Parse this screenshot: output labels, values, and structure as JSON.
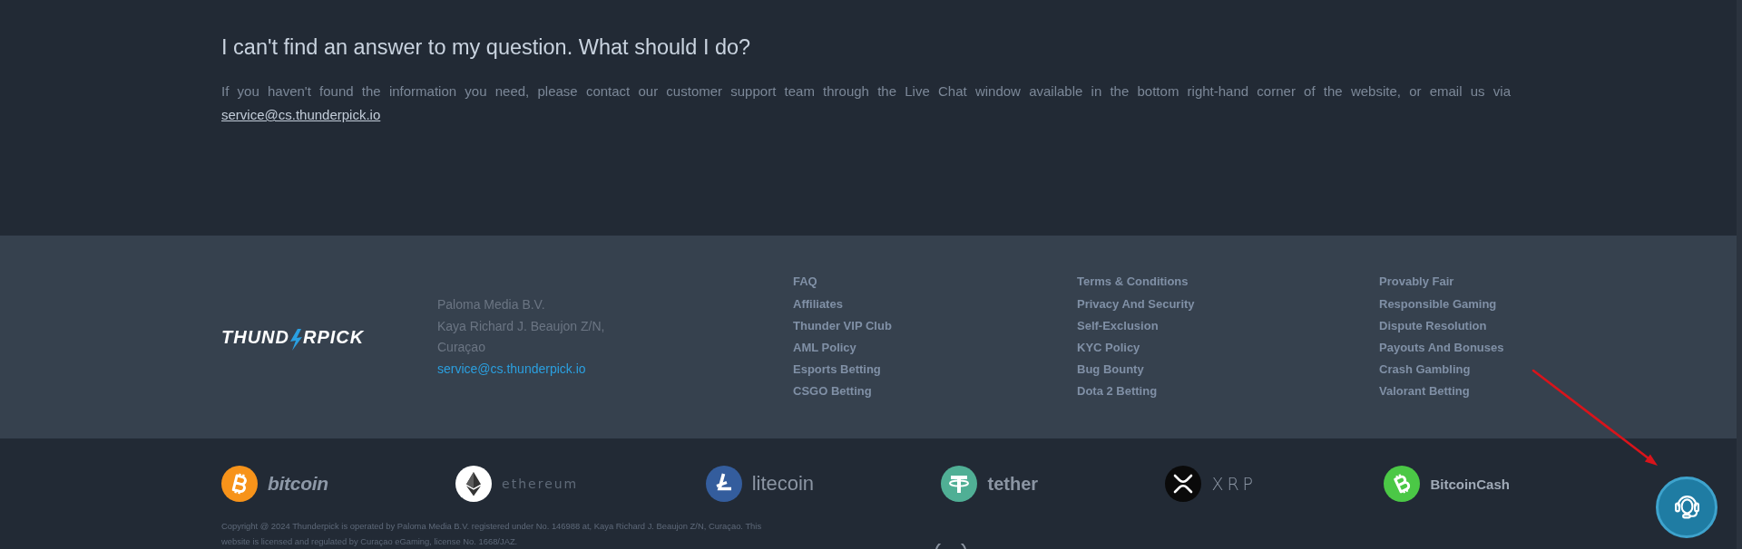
{
  "faq": {
    "question": "I can't find an answer to my question. What should I do?",
    "answer": "If you haven't found the information you need, please contact our customer support team through the Live Chat window available in the bottom right-hand corner of the website, or email us via",
    "email": "service@cs.thunderpick.io"
  },
  "footer": {
    "logo": {
      "before_bolt": "THUND",
      "after_bolt": "RPICK"
    },
    "address": [
      "Paloma Media B.V.",
      "Kaya Richard J. Beaujon Z/N,",
      "Curaçao"
    ],
    "email": "service@cs.thunderpick.io",
    "link_columns": [
      {
        "links": [
          "FAQ",
          "Affiliates",
          "Thunder VIP Club",
          "AML Policy",
          "Esports Betting",
          "CSGO Betting"
        ]
      },
      {
        "links": [
          "Terms & Conditions",
          "Privacy And Security",
          "Self-Exclusion",
          "KYC Policy",
          "Bug Bounty",
          "Dota 2 Betting"
        ]
      },
      {
        "links": [
          "Provably Fair",
          "Responsible Gaming",
          "Dispute Resolution",
          "Payouts And Bonuses",
          "Crash Gambling",
          "Valorant Betting"
        ]
      }
    ]
  },
  "payment_methods": [
    {
      "kind": "bitcoin",
      "label": "bitcoin"
    },
    {
      "kind": "ethereum",
      "label": "ethereum"
    },
    {
      "kind": "litecoin",
      "label": "litecoin"
    },
    {
      "kind": "tether",
      "label": "tether"
    },
    {
      "kind": "xrp",
      "label": "XRP"
    },
    {
      "kind": "bitcoin_cash",
      "label": "BitcoinCash"
    }
  ],
  "copyright": "Copyright @ 2024 Thunderpick is operated by Paloma Media B.V. registered under No. 146988 at, Kaya Richard J. Beaujon Z/N, Curaçao. This website is licensed and regulated by Curaçao eGaming, license No. 1668/JAZ."
}
